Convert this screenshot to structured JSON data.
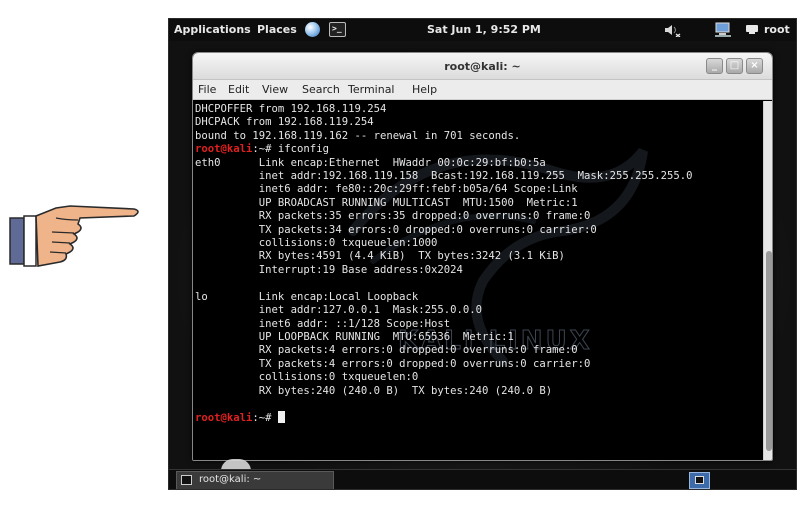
{
  "top_panel": {
    "applications": "Applications",
    "places": "Places",
    "clock": "Sat Jun  1,  9:52 PM",
    "user": "root"
  },
  "window": {
    "title": "root@kali: ~",
    "controls": {
      "minimize": "_",
      "maximize": "□",
      "close": "×"
    },
    "menu": [
      "File",
      "Edit",
      "View",
      "Search",
      "Terminal",
      "Help"
    ]
  },
  "terminal": {
    "lines_top": [
      "DHCPOFFER from 192.168.119.254",
      "DHCPACK from 192.168.119.254",
      "bound to 192.168.119.162 -- renewal in 701 seconds."
    ],
    "prompt_user": "root@kali",
    "prompt_rest": ":~# ",
    "command": "ifconfig",
    "output": [
      "eth0      Link encap:Ethernet  HWaddr 00:0c:29:bf:b0:5a  ",
      "          inet addr:192.168.119.158  Bcast:192.168.119.255  Mask:255.255.255.0",
      "          inet6 addr: fe80::20c:29ff:febf:b05a/64 Scope:Link",
      "          UP BROADCAST RUNNING MULTICAST  MTU:1500  Metric:1",
      "          RX packets:35 errors:35 dropped:0 overruns:0 frame:0",
      "          TX packets:34 errors:0 dropped:0 overruns:0 carrier:0",
      "          collisions:0 txqueuelen:1000 ",
      "          RX bytes:4591 (4.4 KiB)  TX bytes:3242 (3.1 KiB)",
      "          Interrupt:19 Base address:0x2024 ",
      "",
      "lo        Link encap:Local Loopback  ",
      "          inet addr:127.0.0.1  Mask:255.0.0.0",
      "          inet6 addr: ::1/128 Scope:Host",
      "          UP LOOPBACK RUNNING  MTU:65536  Metric:1",
      "          RX packets:4 errors:0 dropped:0 overruns:0 frame:0",
      "          TX packets:4 errors:0 dropped:0 overruns:0 carrier:0",
      "          collisions:0 txqueuelen:0 ",
      "          RX bytes:240 (240.0 B)  TX bytes:240 (240.0 B)",
      ""
    ],
    "prompt_color": "#e02020",
    "background": "#000000",
    "foreground": "#e5e5e5"
  },
  "taskbar": {
    "task_label": "root@kali: ~"
  },
  "icons": {
    "hand": "pointing-hand-icon",
    "browser": "browser-globe-icon",
    "terminal_launcher": "terminal-icon",
    "volume": "volume-muted-icon",
    "network": "network-icon",
    "user": "user-icon"
  }
}
